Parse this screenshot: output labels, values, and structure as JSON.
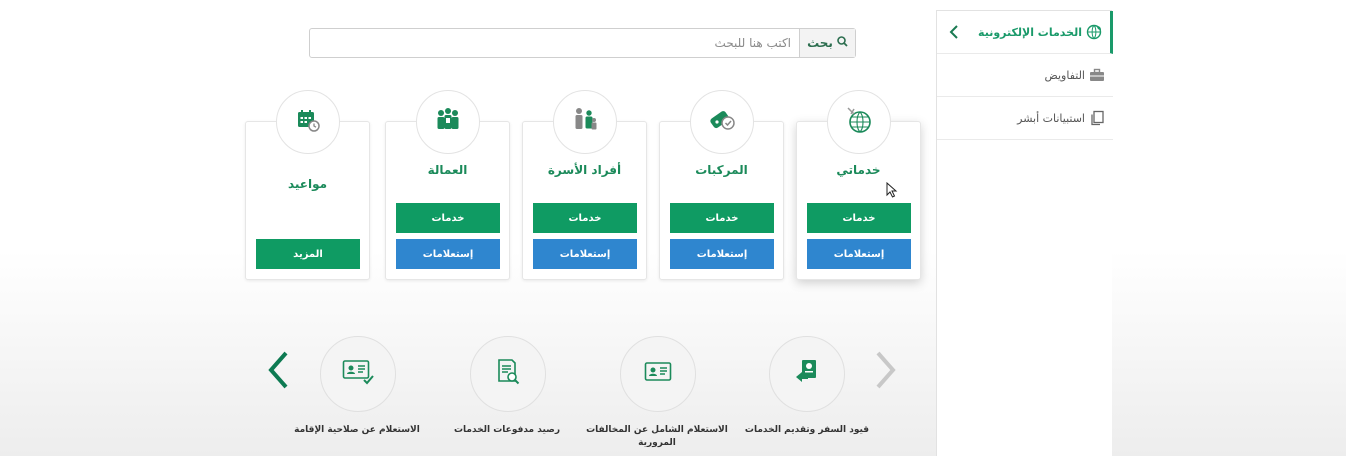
{
  "sidebar": {
    "items": [
      {
        "label": "الخدمات الإلكترونية",
        "icon": "globe-leaf-icon"
      },
      {
        "label": "التفاويض",
        "icon": "briefcase-icon"
      },
      {
        "label": "استبيانات أبشر",
        "icon": "copy-documents-icon"
      }
    ],
    "back_icon": "chevron-left-icon"
  },
  "search": {
    "button_label": "بحث",
    "placeholder": "اكتب هنا للبحث",
    "value": ""
  },
  "cards": [
    {
      "title": "خدماتي",
      "icon": "globe-icon",
      "services_label": "خدمات",
      "inquiries_label": "إستعلامات"
    },
    {
      "title": "المركبات",
      "icon": "car-key-icon",
      "services_label": "خدمات",
      "inquiries_label": "إستعلامات"
    },
    {
      "title": "أفراد الأسرة",
      "icon": "family-icon",
      "services_label": "خدمات",
      "inquiries_label": "إستعلامات"
    },
    {
      "title": "العمالة",
      "icon": "workers-icon",
      "services_label": "خدمات",
      "inquiries_label": "إستعلامات"
    },
    {
      "title": "مواعيد",
      "icon": "calendar-clock-icon",
      "more_label": "المزيد"
    }
  ],
  "quick_services": [
    {
      "label": "قيود السفر وتقديم الخدمات",
      "icon": "travel-document-icon"
    },
    {
      "label": "الاستعلام الشامل عن المخالفات المرورية",
      "icon": "id-card-icon"
    },
    {
      "label": "رصيد مدفوعات الخدمات",
      "icon": "receipt-search-icon"
    },
    {
      "label": "الاستعلام عن صلاحية الإقامة",
      "icon": "id-card-check-icon"
    }
  ],
  "colors": {
    "green": "#0f9b63",
    "blue": "#2f86cf",
    "title_green": "#1b8a5a",
    "arrow_active": "#0d7a52",
    "arrow_inactive": "#c8c8c8"
  }
}
